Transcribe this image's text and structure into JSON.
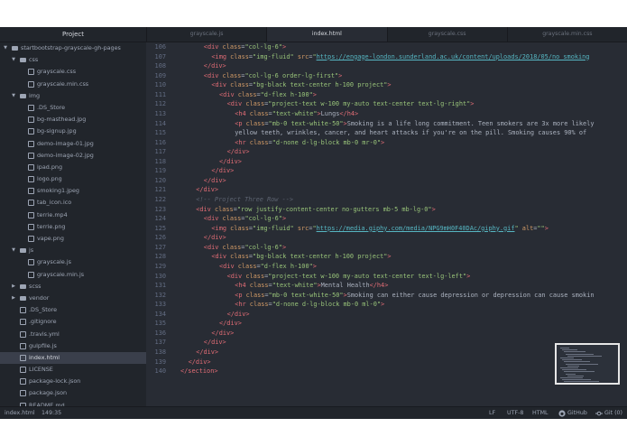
{
  "tree": {
    "title": "Project",
    "items": [
      {
        "label": "startbootstrap-grayscale-gh-pages",
        "depth": 0,
        "kind": "folder",
        "open": true
      },
      {
        "label": "css",
        "depth": 1,
        "kind": "folder",
        "open": true
      },
      {
        "label": "grayscale.css",
        "depth": 2,
        "kind": "file"
      },
      {
        "label": "grayscale.min.css",
        "depth": 2,
        "kind": "file"
      },
      {
        "label": "img",
        "depth": 1,
        "kind": "folder",
        "open": true
      },
      {
        "label": ".DS_Store",
        "depth": 2,
        "kind": "file"
      },
      {
        "label": "bg-masthead.jpg",
        "depth": 2,
        "kind": "file"
      },
      {
        "label": "bg-signup.jpg",
        "depth": 2,
        "kind": "file"
      },
      {
        "label": "demo-image-01.jpg",
        "depth": 2,
        "kind": "file"
      },
      {
        "label": "demo-image-02.jpg",
        "depth": 2,
        "kind": "file"
      },
      {
        "label": "ipad.png",
        "depth": 2,
        "kind": "file"
      },
      {
        "label": "logo.png",
        "depth": 2,
        "kind": "file"
      },
      {
        "label": "smoking1.jpeg",
        "depth": 2,
        "kind": "file"
      },
      {
        "label": "tab_icon.ico",
        "depth": 2,
        "kind": "file"
      },
      {
        "label": "terrie.mp4",
        "depth": 2,
        "kind": "file"
      },
      {
        "label": "terrie.png",
        "depth": 2,
        "kind": "file"
      },
      {
        "label": "vape.png",
        "depth": 2,
        "kind": "file"
      },
      {
        "label": "js",
        "depth": 1,
        "kind": "folder",
        "open": true
      },
      {
        "label": "grayscale.js",
        "depth": 2,
        "kind": "file"
      },
      {
        "label": "grayscale.min.js",
        "depth": 2,
        "kind": "file"
      },
      {
        "label": "scss",
        "depth": 1,
        "kind": "folder",
        "open": false
      },
      {
        "label": "vendor",
        "depth": 1,
        "kind": "folder",
        "open": false
      },
      {
        "label": ".DS_Store",
        "depth": 1,
        "kind": "file"
      },
      {
        "label": ".gitignore",
        "depth": 1,
        "kind": "file"
      },
      {
        "label": ".travis.yml",
        "depth": 1,
        "kind": "file"
      },
      {
        "label": "gulpfile.js",
        "depth": 1,
        "kind": "file"
      },
      {
        "label": "index.html",
        "depth": 1,
        "kind": "file",
        "selected": true
      },
      {
        "label": "LICENSE",
        "depth": 1,
        "kind": "file"
      },
      {
        "label": "package-lock.json",
        "depth": 1,
        "kind": "file"
      },
      {
        "label": "package.json",
        "depth": 1,
        "kind": "file"
      },
      {
        "label": "README.md",
        "depth": 1,
        "kind": "file"
      }
    ]
  },
  "tabs": [
    {
      "label": "grayscale.js",
      "active": false
    },
    {
      "label": "index.html",
      "active": true
    },
    {
      "label": "grayscale.css",
      "active": false
    },
    {
      "label": "grayscale.min.css",
      "active": false
    }
  ],
  "editor": {
    "lines": [
      {
        "num": "106",
        "indent": 6,
        "parts": [
          [
            "t",
            "<div "
          ],
          [
            "a",
            "class"
          ],
          [
            "p",
            "="
          ],
          [
            "s",
            "\"col-lg-6\""
          ],
          [
            "t",
            ">"
          ]
        ]
      },
      {
        "num": "107",
        "indent": 8,
        "parts": [
          [
            "t",
            "<img "
          ],
          [
            "a",
            "class"
          ],
          [
            "p",
            "="
          ],
          [
            "s",
            "\"img-fluid\""
          ],
          [
            "p",
            " "
          ],
          [
            "a",
            "src"
          ],
          [
            "p",
            "="
          ],
          [
            "s",
            "\""
          ],
          [
            "u",
            "https://engage-london.sunderland.ac.uk/content/uploads/2018/05/no_smoking"
          ]
        ]
      },
      {
        "num": "108",
        "indent": 6,
        "parts": [
          [
            "t",
            "</div>"
          ]
        ]
      },
      {
        "num": "109",
        "indent": 6,
        "parts": [
          [
            "t",
            "<div "
          ],
          [
            "a",
            "class"
          ],
          [
            "p",
            "="
          ],
          [
            "s",
            "\"col-lg-6 order-lg-first\""
          ],
          [
            "t",
            ">"
          ]
        ]
      },
      {
        "num": "110",
        "indent": 8,
        "parts": [
          [
            "t",
            "<div "
          ],
          [
            "a",
            "class"
          ],
          [
            "p",
            "="
          ],
          [
            "s",
            "\"bg-black text-center h-100 project\""
          ],
          [
            "t",
            ">"
          ]
        ]
      },
      {
        "num": "111",
        "indent": 10,
        "parts": [
          [
            "t",
            "<div "
          ],
          [
            "a",
            "class"
          ],
          [
            "p",
            "="
          ],
          [
            "s",
            "\"d-flex h-100\""
          ],
          [
            "t",
            ">"
          ]
        ]
      },
      {
        "num": "112",
        "indent": 12,
        "parts": [
          [
            "t",
            "<div "
          ],
          [
            "a",
            "class"
          ],
          [
            "p",
            "="
          ],
          [
            "s",
            "\"project-text w-100 my-auto text-center text-lg-right\""
          ],
          [
            "t",
            ">"
          ]
        ]
      },
      {
        "num": "113",
        "indent": 14,
        "parts": [
          [
            "t",
            "<h4 "
          ],
          [
            "a",
            "class"
          ],
          [
            "p",
            "="
          ],
          [
            "s",
            "\"text-white\""
          ],
          [
            "t",
            ">"
          ],
          [
            "p",
            "Lungs"
          ],
          [
            "t",
            "</h4>"
          ]
        ]
      },
      {
        "num": "114",
        "indent": 14,
        "parts": [
          [
            "t",
            "<p "
          ],
          [
            "a",
            "class"
          ],
          [
            "p",
            "="
          ],
          [
            "s",
            "\"mb-0 text-white-50\""
          ],
          [
            "t",
            ">"
          ],
          [
            "p",
            "Smoking is a life long commitment. Teen smokers are 3x more likely"
          ]
        ]
      },
      {
        "num": "115",
        "indent": 14,
        "parts": [
          [
            "p",
            "yellow teeth, wrinkles, cancer, and heart attacks if you're on the pill. Smoking causes 90% of"
          ]
        ]
      },
      {
        "num": "116",
        "indent": 14,
        "parts": [
          [
            "t",
            "<hr "
          ],
          [
            "a",
            "class"
          ],
          [
            "p",
            "="
          ],
          [
            "s",
            "\"d-none d-lg-block mb-0 mr-0\""
          ],
          [
            "t",
            ">"
          ]
        ]
      },
      {
        "num": "117",
        "indent": 12,
        "parts": [
          [
            "t",
            "</div>"
          ]
        ]
      },
      {
        "num": "118",
        "indent": 10,
        "parts": [
          [
            "t",
            "</div>"
          ]
        ]
      },
      {
        "num": "119",
        "indent": 8,
        "parts": [
          [
            "t",
            "</div>"
          ]
        ]
      },
      {
        "num": "120",
        "indent": 6,
        "parts": [
          [
            "t",
            "</div>"
          ]
        ]
      },
      {
        "num": "121",
        "indent": 4,
        "parts": [
          [
            "t",
            "</div>"
          ]
        ]
      },
      {
        "num": "122",
        "indent": 4,
        "parts": [
          [
            "c",
            "<!-- Project Three Row -->"
          ]
        ]
      },
      {
        "num": "123",
        "indent": 4,
        "parts": [
          [
            "t",
            "<div "
          ],
          [
            "a",
            "class"
          ],
          [
            "p",
            "="
          ],
          [
            "s",
            "\"row justify-content-center no-gutters mb-5 mb-lg-0\""
          ],
          [
            "t",
            ">"
          ]
        ]
      },
      {
        "num": "124",
        "indent": 6,
        "parts": [
          [
            "t",
            "<div "
          ],
          [
            "a",
            "class"
          ],
          [
            "p",
            "="
          ],
          [
            "s",
            "\"col-lg-6\""
          ],
          [
            "t",
            ">"
          ]
        ]
      },
      {
        "num": "125",
        "indent": 8,
        "parts": [
          [
            "t",
            "<img "
          ],
          [
            "a",
            "class"
          ],
          [
            "p",
            "="
          ],
          [
            "s",
            "\"img-fluid\""
          ],
          [
            "p",
            " "
          ],
          [
            "a",
            "src"
          ],
          [
            "p",
            "="
          ],
          [
            "s",
            "\""
          ],
          [
            "u",
            "https://media.giphy.com/media/NPG9mH0F40DAc/giphy.gif"
          ],
          [
            "s",
            "\""
          ],
          [
            "p",
            " "
          ],
          [
            "a",
            "alt"
          ],
          [
            "p",
            "="
          ],
          [
            "s",
            "\"\""
          ],
          [
            "t",
            ">"
          ]
        ]
      },
      {
        "num": "126",
        "indent": 6,
        "parts": [
          [
            "t",
            "</div>"
          ]
        ]
      },
      {
        "num": "127",
        "indent": 6,
        "parts": [
          [
            "t",
            "<div "
          ],
          [
            "a",
            "class"
          ],
          [
            "p",
            "="
          ],
          [
            "s",
            "\"col-lg-6\""
          ],
          [
            "t",
            ">"
          ]
        ]
      },
      {
        "num": "128",
        "indent": 8,
        "parts": [
          [
            "t",
            "<div "
          ],
          [
            "a",
            "class"
          ],
          [
            "p",
            "="
          ],
          [
            "s",
            "\"bg-black text-center h-100 project\""
          ],
          [
            "t",
            ">"
          ]
        ]
      },
      {
        "num": "129",
        "indent": 10,
        "parts": [
          [
            "t",
            "<div "
          ],
          [
            "a",
            "class"
          ],
          [
            "p",
            "="
          ],
          [
            "s",
            "\"d-flex h-100\""
          ],
          [
            "t",
            ">"
          ]
        ]
      },
      {
        "num": "130",
        "indent": 12,
        "parts": [
          [
            "t",
            "<div "
          ],
          [
            "a",
            "class"
          ],
          [
            "p",
            "="
          ],
          [
            "s",
            "\"project-text w-100 my-auto text-center text-lg-left\""
          ],
          [
            "t",
            ">"
          ]
        ]
      },
      {
        "num": "131",
        "indent": 14,
        "parts": [
          [
            "t",
            "<h4 "
          ],
          [
            "a",
            "class"
          ],
          [
            "p",
            "="
          ],
          [
            "s",
            "\"text-white\""
          ],
          [
            "t",
            ">"
          ],
          [
            "p",
            "Mental Health"
          ],
          [
            "t",
            "</h4>"
          ]
        ]
      },
      {
        "num": "132",
        "indent": 14,
        "parts": [
          [
            "t",
            "<p "
          ],
          [
            "a",
            "class"
          ],
          [
            "p",
            "="
          ],
          [
            "s",
            "\"mb-0 text-white-50\""
          ],
          [
            "t",
            ">"
          ],
          [
            "p",
            "Smoking can either cause depression or depression can cause smokin"
          ]
        ]
      },
      {
        "num": "133",
        "indent": 14,
        "parts": [
          [
            "t",
            "<hr "
          ],
          [
            "a",
            "class"
          ],
          [
            "p",
            "="
          ],
          [
            "s",
            "\"d-none d-lg-block mb-0 ml-0\""
          ],
          [
            "t",
            ">"
          ]
        ]
      },
      {
        "num": "134",
        "indent": 12,
        "parts": [
          [
            "t",
            "</div>"
          ]
        ]
      },
      {
        "num": "135",
        "indent": 10,
        "parts": [
          [
            "t",
            "</div>"
          ]
        ]
      },
      {
        "num": "136",
        "indent": 8,
        "parts": [
          [
            "t",
            "</div>"
          ]
        ]
      },
      {
        "num": "137",
        "indent": 6,
        "parts": [
          [
            "t",
            "</div>"
          ]
        ]
      },
      {
        "num": "138",
        "indent": 4,
        "parts": [
          [
            "t",
            "</div>"
          ]
        ]
      },
      {
        "num": "139",
        "indent": 2,
        "parts": [
          [
            "t",
            "</div>"
          ]
        ]
      },
      {
        "num": "140",
        "indent": 0,
        "parts": [
          [
            "t",
            "</section>"
          ]
        ]
      }
    ]
  },
  "status": {
    "file": "index.html",
    "cursor": "149:35",
    "line_ending": "LF",
    "encoding": "UTF-8",
    "grammar": "HTML",
    "github": "GitHub",
    "git": "Git (0)"
  },
  "colors": {
    "tag": "#e06c75",
    "attr": "#d19a66",
    "string": "#98c379",
    "link": "#56b6c2",
    "comment": "#5c6370"
  }
}
